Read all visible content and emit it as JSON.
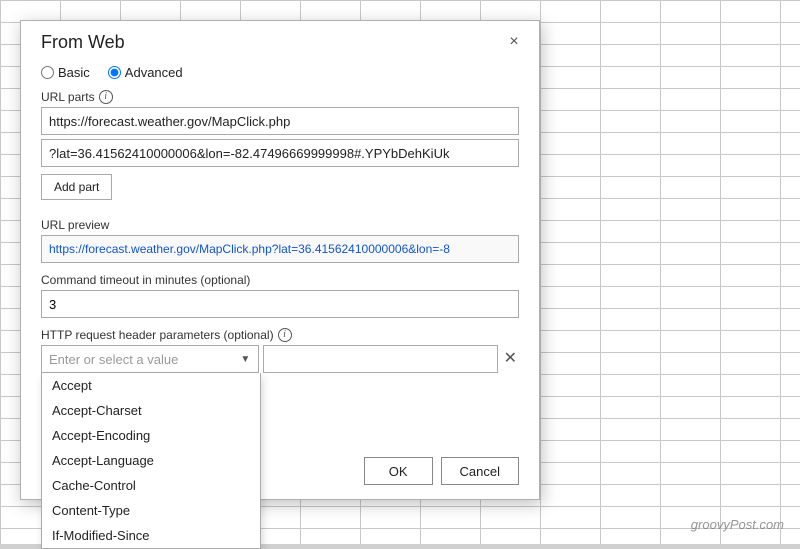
{
  "dialog": {
    "title": "From Web",
    "close_label": "×"
  },
  "radio": {
    "basic_label": "Basic",
    "advanced_label": "Advanced",
    "selected": "advanced"
  },
  "url_parts": {
    "label": "URL parts",
    "part1_value": "https://forecast.weather.gov/MapClick.php",
    "part2_value": "?lat=36.41562410000006&lon=-82.47496669999998#.YPYbDehKiUk",
    "add_part_label": "Add part"
  },
  "url_preview": {
    "label": "URL preview",
    "value": "https://forecast.weather.gov/MapClick.php?lat=36.41562410000006&lon=-8"
  },
  "timeout": {
    "label": "Command timeout in minutes (optional)",
    "value": "3"
  },
  "http": {
    "label": "HTTP request header parameters (optional)",
    "placeholder": "Enter or select a value",
    "dropdown_items": [
      "Accept",
      "Accept-Charset",
      "Accept-Encoding",
      "Accept-Language",
      "Cache-Control",
      "Content-Type",
      "If-Modified-Since"
    ]
  },
  "footer": {
    "ok_label": "OK",
    "cancel_label": "Cancel"
  },
  "watermark": "groovyPost.com"
}
